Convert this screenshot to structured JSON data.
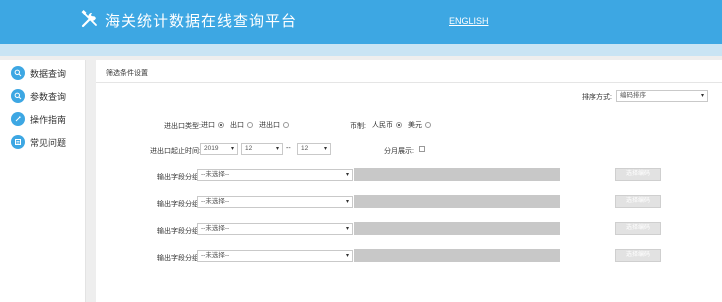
{
  "header": {
    "title": "海关统计数据在线查询平台",
    "lang_link": "ENGLISH"
  },
  "sidebar": {
    "items": [
      {
        "label": "数据查询",
        "icon": "search-icon"
      },
      {
        "label": "参数查询",
        "icon": "magnifier-icon"
      },
      {
        "label": "操作指南",
        "icon": "guide-icon"
      },
      {
        "label": "常见问题",
        "icon": "faq-icon"
      }
    ]
  },
  "panel": {
    "title": "筛选条件设置",
    "sort_label": "排序方式:",
    "sort_value": "编码排序",
    "trade_type_label": "进出口类型:",
    "trade_options": [
      "进口",
      "出口",
      "进出口"
    ],
    "trade_selected": "进口",
    "currency_label": "币制:",
    "currency_options": [
      "人民币",
      "美元"
    ],
    "currency_selected": "人民币",
    "period_label": "进出口起止时间:",
    "year": "2019",
    "month_start": "12",
    "range_sep": "--",
    "month_end": "12",
    "monthly_label": "分月展示:",
    "output_rows": [
      {
        "label": "输出字段分组:",
        "select_placeholder": "--未选择--",
        "button": "选择编码"
      },
      {
        "label": "输出字段分组:",
        "select_placeholder": "--未选择--",
        "button": "选择编码"
      },
      {
        "label": "输出字段分组:",
        "select_placeholder": "--未选择--",
        "button": "选择编码"
      },
      {
        "label": "输出字段分组:",
        "select_placeholder": "--未选择--",
        "button": "选择编码"
      }
    ]
  },
  "colors": {
    "header_blue": "#3da7e3",
    "subbar": "#c9e4f4",
    "grey_bar": "#c8c8c8",
    "button_bg": "#e2e2e2"
  }
}
